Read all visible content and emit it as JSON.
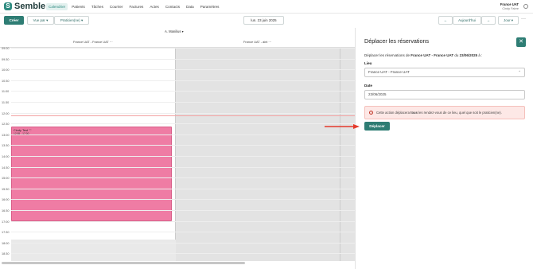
{
  "brand": {
    "name": "Semble",
    "accent": "#2e7d74"
  },
  "nav": [
    {
      "label": "Calendrier",
      "active": true
    },
    {
      "label": "Patients"
    },
    {
      "label": "Tâches"
    },
    {
      "label": "Courrier"
    },
    {
      "label": "Factures"
    },
    {
      "label": "Actes"
    },
    {
      "label": "Contacts"
    },
    {
      "label": "Data"
    },
    {
      "label": "Paramètres"
    }
  ],
  "clinic": {
    "name": "France UAT",
    "user": "Cindy Fabre"
  },
  "toolbar": {
    "create": "Créer",
    "view_by": "Vue par ▾",
    "practitioner": "Praticien(ne) ▾",
    "date": "lun. 23 juin 2025",
    "today": "Aujourd'hui",
    "prev": "←",
    "next": "→",
    "range": "Jour ▾",
    "more": "···"
  },
  "calendar": {
    "subheader": "A. Manilius ▾",
    "columns": [
      "France UAT - France UAT ···",
      "France UAT - aint ···"
    ],
    "times": [
      "09:00",
      "09:30",
      "10:00",
      "10:30",
      "11:00",
      "11:30",
      "12:00",
      "12:30",
      "13:00",
      "13:30",
      "14:00",
      "14:30",
      "15:00",
      "15:30",
      "16:00",
      "16:30",
      "17:00",
      "17:30",
      "18:00",
      "18:30"
    ],
    "event": {
      "title": "Cindy Test ♡",
      "time": "12:55 - 17:00",
      "color": "#ef7ca4"
    }
  },
  "panel": {
    "title": "Déplacer les réservations",
    "close": "✕",
    "desc_pre": "Déplacer les réservations de ",
    "desc_bold": "France UAT - France UAT",
    "desc_mid": " du ",
    "desc_date": "23/06/2025",
    "desc_post": " à :",
    "lieu_label": "Lieu",
    "lieu_value": "France UAT - France UAT",
    "date_label": "Date",
    "date_value": "23/06/2025",
    "alert_pre": "Cette action déplacera ",
    "alert_bold": "tous",
    "alert_post": " les rendez-vous de ce lieu, quel que soit le praticien(ne).",
    "submit": "Déplacer"
  }
}
